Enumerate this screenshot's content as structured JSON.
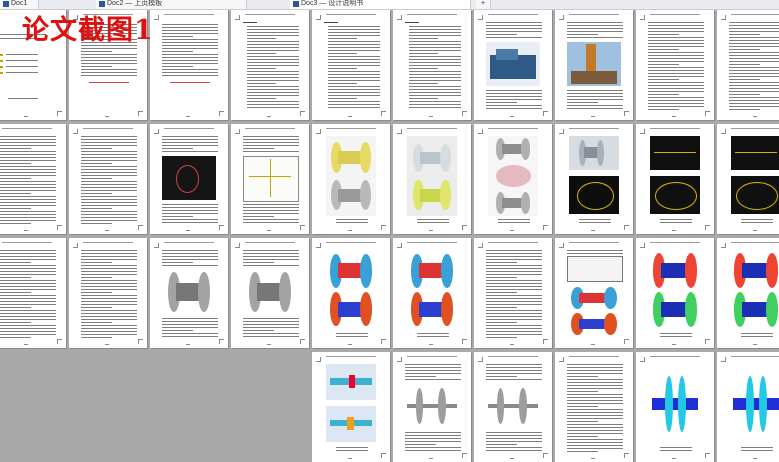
{
  "window": {
    "tabs": [
      {
        "label": "Doc1",
        "active": false
      },
      {
        "label": "Doc2 — 上页模板",
        "active": false
      },
      {
        "label": "Doc3 — 设计说明书",
        "active": true
      },
      {
        "label": "+",
        "active": false
      }
    ]
  },
  "overlay": {
    "watermark_text": "论文截图1",
    "watermark_color": "#e01010"
  },
  "view": {
    "mode": "multi-page thumbnails",
    "rows": 4,
    "columns": 10
  },
  "pages": [
    {
      "row": 1,
      "col": 1,
      "kind": "cover"
    },
    {
      "row": 1,
      "col": 2,
      "kind": "abstract-cn"
    },
    {
      "row": 1,
      "col": 3,
      "kind": "abstract-en"
    },
    {
      "row": 1,
      "col": 4,
      "kind": "toc"
    },
    {
      "row": 1,
      "col": 5,
      "kind": "toc"
    },
    {
      "row": 1,
      "col": 6,
      "kind": "toc"
    },
    {
      "row": 1,
      "col": 7,
      "kind": "text-figure",
      "figure": "machine"
    },
    {
      "row": 1,
      "col": 8,
      "kind": "text-figure",
      "figure": "drilling-rig"
    },
    {
      "row": 1,
      "col": 9,
      "kind": "text"
    },
    {
      "row": 1,
      "col": 10,
      "kind": "text"
    },
    {
      "row": 2,
      "col": 1,
      "kind": "text"
    },
    {
      "row": 2,
      "col": 2,
      "kind": "text"
    },
    {
      "row": 2,
      "col": 3,
      "kind": "text-figure",
      "figure": "cad-dark"
    },
    {
      "row": 2,
      "col": 4,
      "kind": "text-figure",
      "figure": "cad-sketch"
    },
    {
      "row": 2,
      "col": 5,
      "kind": "figures",
      "figure": "yellow-drum"
    },
    {
      "row": 2,
      "col": 6,
      "kind": "figures",
      "figure": "drum-model"
    },
    {
      "row": 2,
      "col": 7,
      "kind": "figures",
      "figure": "drum-grey"
    },
    {
      "row": 2,
      "col": 8,
      "kind": "figures",
      "figure": "cad-screens"
    },
    {
      "row": 2,
      "col": 9,
      "kind": "figures",
      "figure": "cad-dark-pair"
    },
    {
      "row": 2,
      "col": 10,
      "kind": "figures",
      "figure": "cad-dark-pair"
    },
    {
      "row": 3,
      "col": 1,
      "kind": "text"
    },
    {
      "row": 3,
      "col": 2,
      "kind": "text"
    },
    {
      "row": 3,
      "col": 3,
      "kind": "text-figure",
      "figure": "spool-table"
    },
    {
      "row": 3,
      "col": 4,
      "kind": "text-figure",
      "figure": "spool"
    },
    {
      "row": 3,
      "col": 5,
      "kind": "figures",
      "figure": "fea-spool"
    },
    {
      "row": 3,
      "col": 6,
      "kind": "figures",
      "figure": "fea-spool"
    },
    {
      "row": 3,
      "col": 7,
      "kind": "text"
    },
    {
      "row": 3,
      "col": 8,
      "kind": "table-figure",
      "figure": "fea-spool"
    },
    {
      "row": 3,
      "col": 9,
      "kind": "figures",
      "figure": "fea-blue"
    },
    {
      "row": 3,
      "col": 10,
      "kind": "figures",
      "figure": "fea-blue"
    },
    {
      "row": 4,
      "col": 5,
      "kind": "figures",
      "figure": "fea-shaft"
    },
    {
      "row": 4,
      "col": 6,
      "kind": "text-figure",
      "figure": "shaft-grey"
    },
    {
      "row": 4,
      "col": 7,
      "kind": "text-figure",
      "figure": "shaft-grey"
    },
    {
      "row": 4,
      "col": 8,
      "kind": "text"
    },
    {
      "row": 4,
      "col": 9,
      "kind": "figures",
      "figure": "fea-shaft-cyan"
    },
    {
      "row": 4,
      "col": 10,
      "kind": "figures",
      "figure": "fea-shaft-cyan"
    }
  ]
}
